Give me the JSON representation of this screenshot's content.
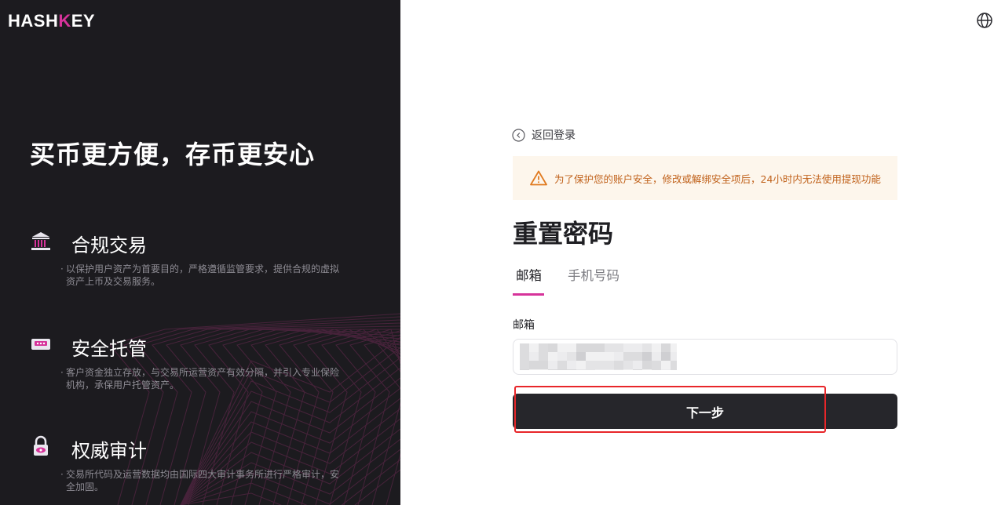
{
  "brand": {
    "logo_text_a": "HASH",
    "logo_text_b": "K",
    "logo_text_c": "EY"
  },
  "left": {
    "headline": "买币更方便，存币更安心",
    "features": [
      {
        "icon": "bank-icon",
        "title": "合规交易",
        "desc": "以保护用户资产为首要目的，严格遵循监管要求，提供合规的虚拟资产上币及交易服务。"
      },
      {
        "icon": "vault-icon",
        "title": "安全托管",
        "desc": "客户资金独立存放，与交易所运营资产有效分隔，并引入专业保险机构，承保用户托管资产。"
      },
      {
        "icon": "lock-eye-icon",
        "title": "权威审计",
        "desc": "交易所代码及运营数据均由国际四大审计事务所进行严格审计，安全加固。"
      }
    ]
  },
  "header": {
    "language_icon": "globe-icon"
  },
  "form": {
    "back_label": "返回登录",
    "warning": "为了保护您的账户安全，修改或解绑安全项后，24小时内无法使用提现功能",
    "title": "重置密码",
    "tabs": [
      {
        "label": "邮箱",
        "active": true
      },
      {
        "label": "手机号码",
        "active": false
      }
    ],
    "email_label": "邮箱",
    "email_value": "",
    "next_label": "下一步"
  },
  "colors": {
    "accent": "#d6339a",
    "dark_panel": "#1c1b1f",
    "button": "#26262b",
    "warning_text": "#c0611a",
    "warning_bg": "#fdf6ec",
    "highlight": "#e8262a"
  }
}
